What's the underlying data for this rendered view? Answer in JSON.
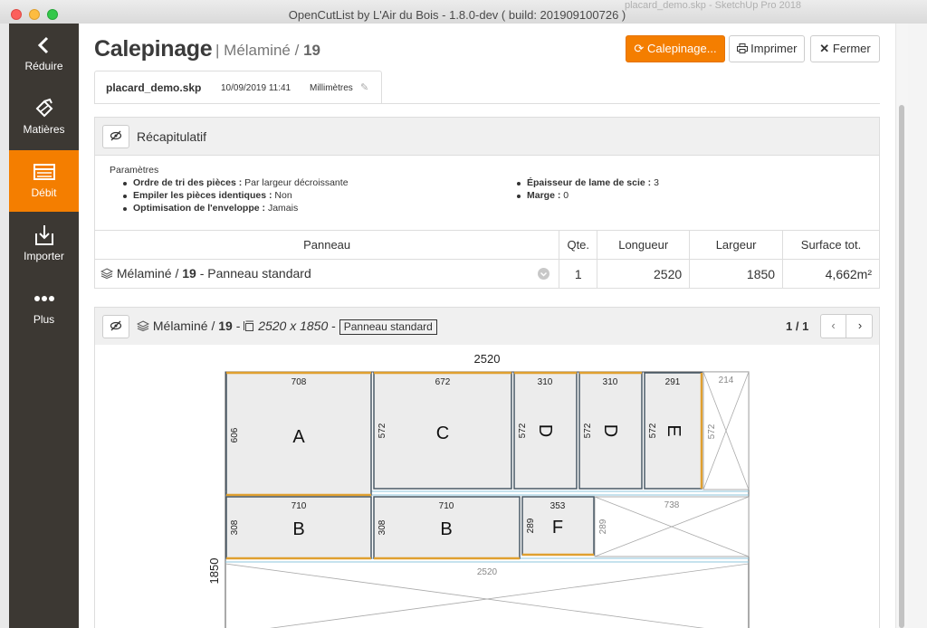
{
  "window": {
    "title": "OpenCutList by L'Air du Bois - 1.8.0-dev ( build: 201909100726 )",
    "background_title": "placard_demo.skp - SketchUp Pro 2018"
  },
  "sidebar": {
    "items": [
      {
        "label": "Réduire",
        "icon": "chevron-left-icon",
        "active": false
      },
      {
        "label": "Matières",
        "icon": "material-icon",
        "active": false
      },
      {
        "label": "Débit",
        "icon": "list-icon",
        "active": true
      },
      {
        "label": "Importer",
        "icon": "import-icon",
        "active": false
      },
      {
        "label": "Plus",
        "icon": "more-dots-icon",
        "active": false
      }
    ]
  },
  "header": {
    "title": "Calepinage",
    "separator": "|",
    "material": "Mélaminé",
    "slash": "/",
    "thickness": "19",
    "buttons": {
      "calepinage": "Calepinage...",
      "print": "Imprimer",
      "close": "Fermer"
    }
  },
  "tab": {
    "filename": "placard_demo.skp",
    "date": "10/09/2019 11:41",
    "units": "Millimètres"
  },
  "summary": {
    "title": "Récapitulatif",
    "params_title": "Paramètres",
    "params_left": [
      {
        "label": "Ordre de tri des pièces :",
        "value": "Par largeur décroissante"
      },
      {
        "label": "Empiler les pièces identiques :",
        "value": "Non"
      },
      {
        "label": "Optimisation de l'enveloppe :",
        "value": "Jamais"
      }
    ],
    "params_right": [
      {
        "label": "Épaisseur de lame de scie :",
        "value": "3"
      },
      {
        "label": "Marge :",
        "value": "0"
      }
    ],
    "table": {
      "headers": [
        "Panneau",
        "Qte.",
        "Longueur",
        "Largeur",
        "Surface tot."
      ],
      "row": {
        "material": "Mélaminé",
        "slash": "/",
        "thickness": "19",
        "dash": "-",
        "panel_type": "Panneau standard",
        "qty": "1",
        "length": "2520",
        "width": "1850",
        "area": "4,662m²"
      }
    }
  },
  "sheet": {
    "material": "Mélaminé",
    "slash": "/",
    "thickness": "19",
    "dash1": "-",
    "dims": "2520 x 1850",
    "dash2": "-",
    "panel_type": "Panneau standard",
    "pagination": "1 / 1",
    "length_label": "2520",
    "width_label": "1850",
    "parts": [
      {
        "label": "A",
        "length": "708",
        "width": "606"
      },
      {
        "label": "C",
        "length": "672",
        "width": "572"
      },
      {
        "label": "D",
        "length": "310",
        "width": "572"
      },
      {
        "label": "D",
        "length": "310",
        "width": "572"
      },
      {
        "label": "E",
        "length": "291",
        "width": "572"
      },
      {
        "label": "B",
        "length": "710",
        "width": "308"
      },
      {
        "label": "B",
        "length": "710",
        "width": "308"
      },
      {
        "label": "F",
        "length": "353",
        "width": "289"
      }
    ],
    "offcuts": [
      {
        "length": "214",
        "width": "572"
      },
      {
        "length": "738",
        "width": "289"
      },
      {
        "length": "2520",
        "width": ""
      }
    ]
  },
  "colors": {
    "accent": "#f47e00",
    "sidebar": "#3c3833",
    "part_fill": "#ececec",
    "part_border": "#4a5a66",
    "grain_edge": "#e0a030",
    "offcut_line": "#8ec5dc"
  }
}
